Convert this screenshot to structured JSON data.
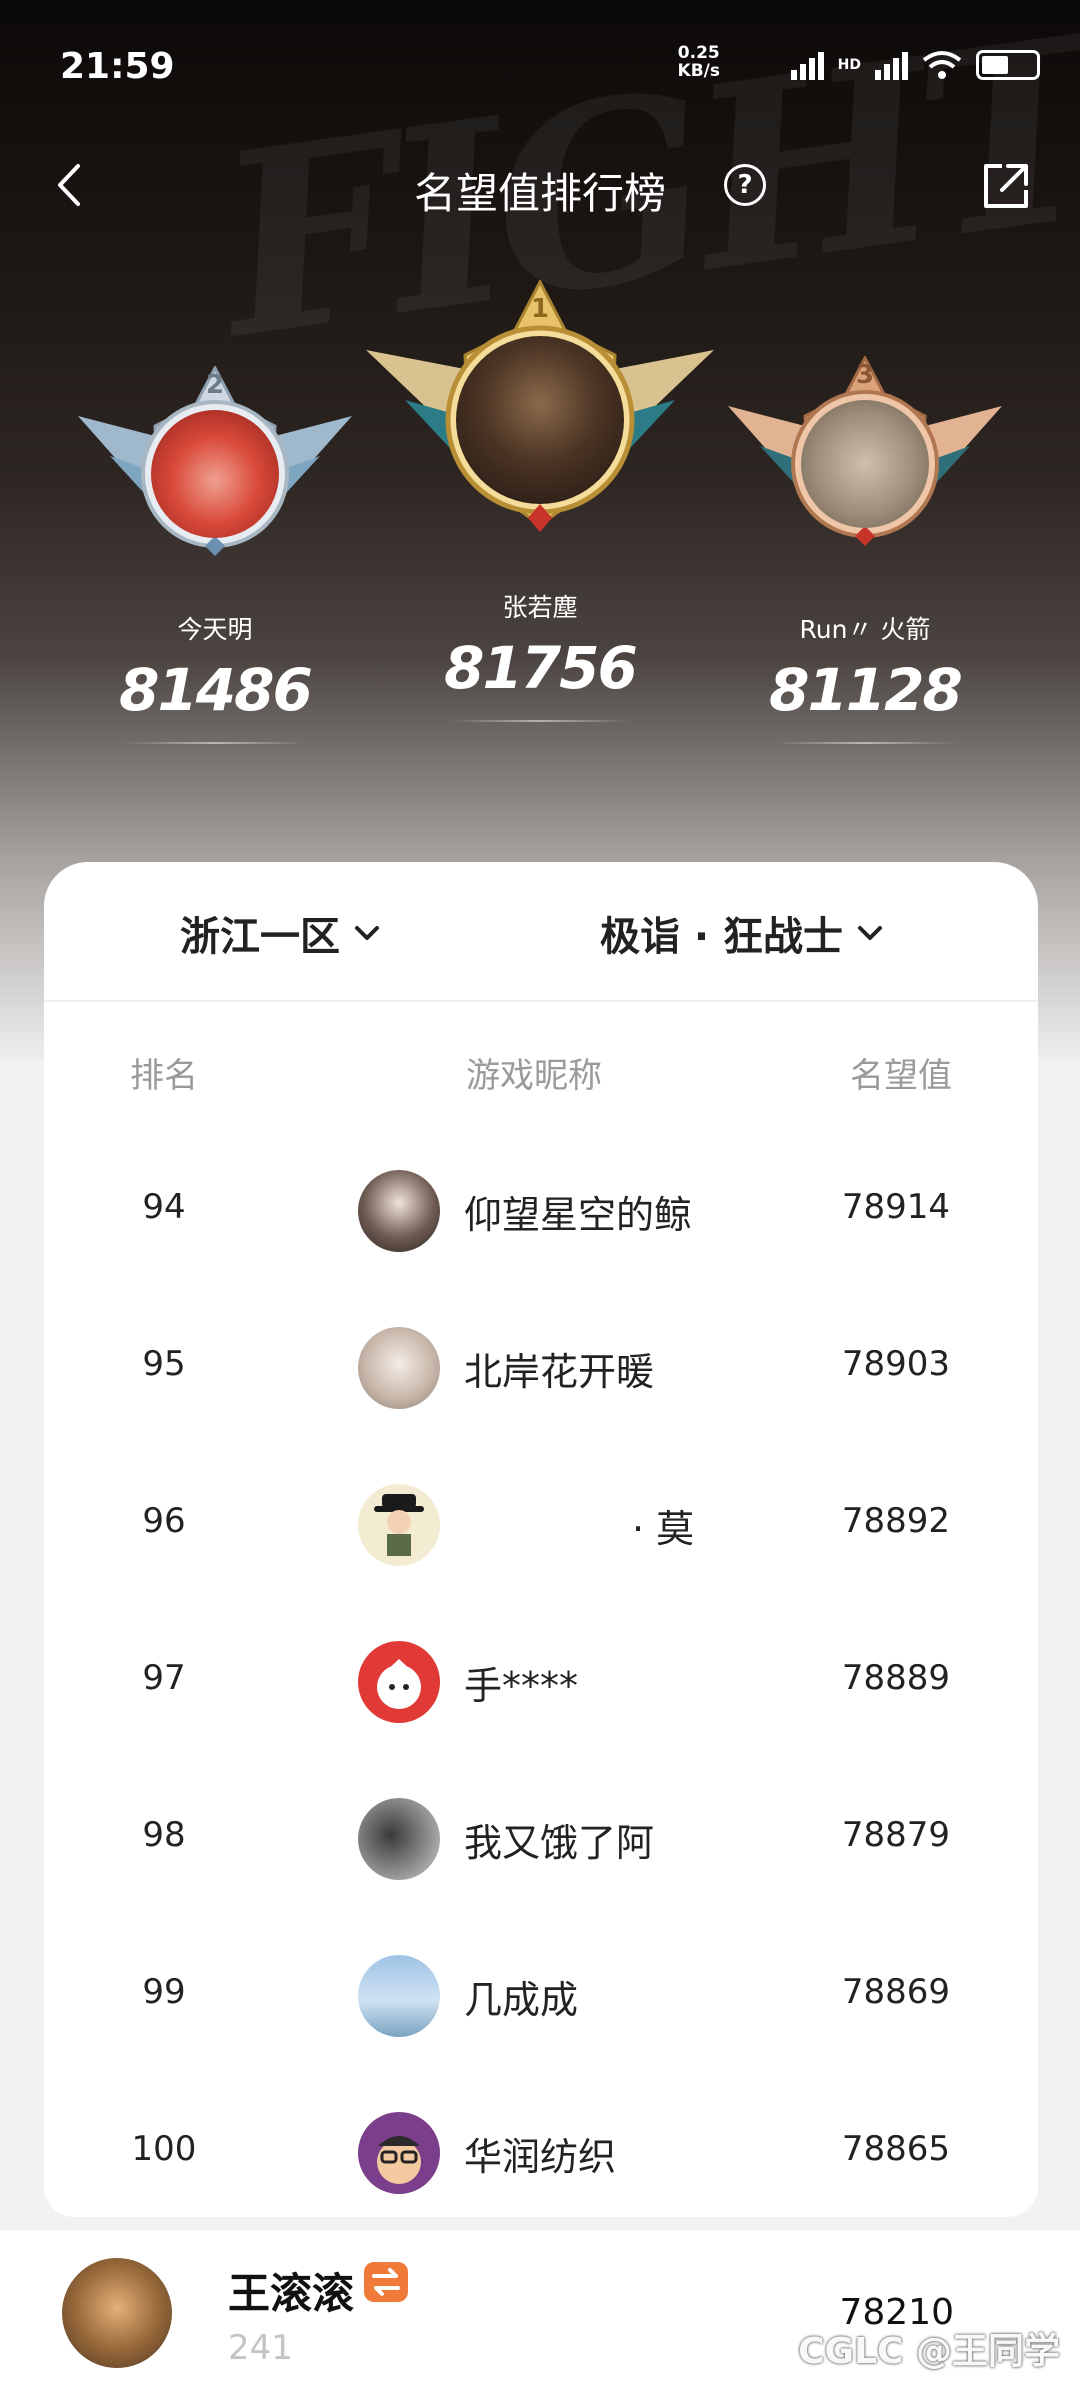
{
  "status_bar": {
    "time": "21:59",
    "network_speed": "0.25",
    "network_unit": "KB/s",
    "hd_label": "HD"
  },
  "nav": {
    "title": "名望值排行榜",
    "help_symbol": "?"
  },
  "background_text": "FIGHT",
  "podium": [
    {
      "rank": "2",
      "name": "今天明",
      "score": "81486"
    },
    {
      "rank": "1",
      "name": "张若塵",
      "score": "81756"
    },
    {
      "rank": "3",
      "name": "Run〃 火箭",
      "score": "81128"
    }
  ],
  "filters": {
    "region": "浙江一区",
    "hero": "极诣 · 狂战士"
  },
  "table": {
    "headers": {
      "rank": "排名",
      "name": "游戏昵称",
      "score": "名望值"
    },
    "rows": [
      {
        "rank": "94",
        "name": "仰望星空的鲸",
        "score": "78914",
        "avatar": "dark-hair-avatar"
      },
      {
        "rank": "95",
        "name": "北岸花开暖",
        "score": "78903",
        "avatar": "anime-girl-avatar"
      },
      {
        "rank": "96",
        "name": "· 莫",
        "score": "78892",
        "avatar": "cartoon-hat-avatar"
      },
      {
        "rank": "97",
        "name": "手****",
        "score": "78889",
        "avatar": "red-mascot-avatar"
      },
      {
        "rank": "98",
        "name": "我又饿了阿",
        "score": "78879",
        "avatar": "sleeping-cat-avatar"
      },
      {
        "rank": "99",
        "name": "几成成",
        "score": "78869",
        "avatar": "seaside-avatar"
      },
      {
        "rank": "100",
        "name": "华润纺织",
        "score": "78865",
        "avatar": "glasses-cartoon-avatar"
      }
    ]
  },
  "me": {
    "name": "王滚滚",
    "rank": "241",
    "score": "78210"
  },
  "watermark": "CGLC @王同学",
  "colors": {
    "gold": "#e9c36b",
    "silver": "#c9d3dc",
    "bronze": "#d9a27a",
    "accent_tag": "#f07a3a"
  }
}
